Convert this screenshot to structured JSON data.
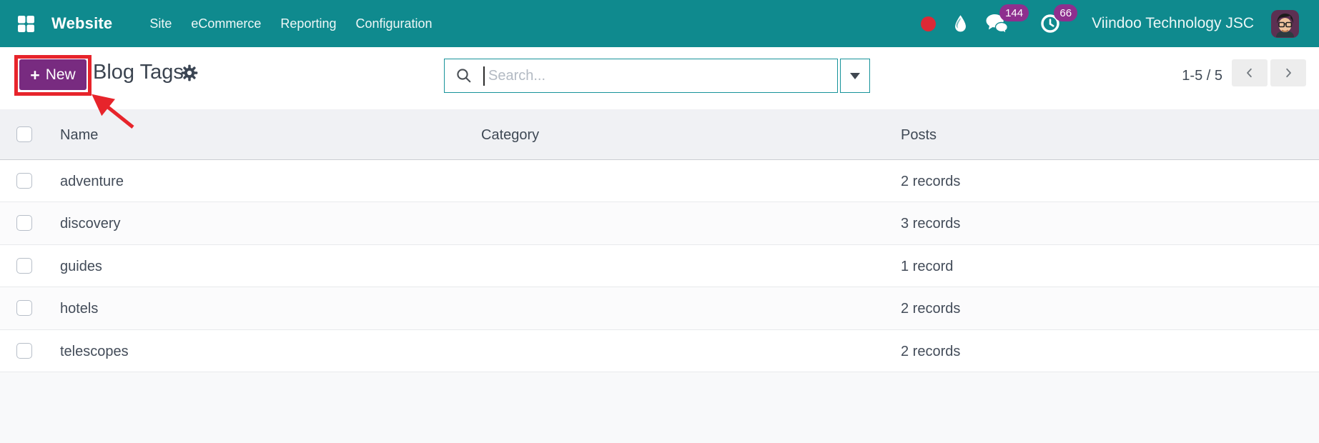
{
  "navbar": {
    "app_name": "Website",
    "menu": [
      "Site",
      "eCommerce",
      "Reporting",
      "Configuration"
    ],
    "messages_badge": "144",
    "activities_badge": "66",
    "company_name": "Viindoo Technology JSC"
  },
  "control_panel": {
    "new_button": {
      "plus": "+",
      "label": "New"
    },
    "title": "Blog Tags",
    "search": {
      "placeholder": "Search..."
    },
    "pager": {
      "range_display": "1-5 / 5"
    }
  },
  "table": {
    "headers": {
      "name": "Name",
      "category": "Category",
      "posts": "Posts"
    },
    "rows": [
      {
        "name": "adventure",
        "category": "",
        "posts": "2 records"
      },
      {
        "name": "discovery",
        "category": "",
        "posts": "3 records"
      },
      {
        "name": "guides",
        "category": "",
        "posts": "1 record"
      },
      {
        "name": "hotels",
        "category": "",
        "posts": "2 records"
      },
      {
        "name": "telescopes",
        "category": "",
        "posts": "2 records"
      }
    ]
  },
  "colors": {
    "navbar_teal": "#0F8A8E",
    "primary_button_purple": "#782B80",
    "badge_purple": "#8E2F8E",
    "record_dot_red": "#DC2936",
    "annotation_red": "#E7242B",
    "search_border_teal": "#17939A"
  }
}
